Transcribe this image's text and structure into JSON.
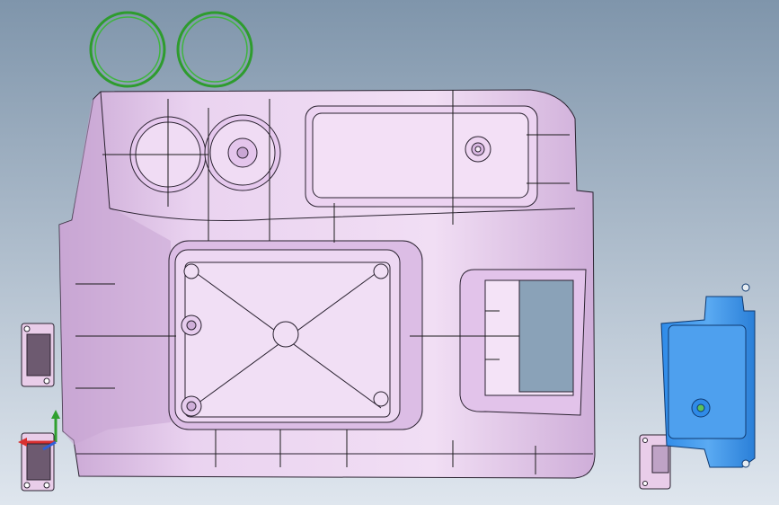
{
  "viewport": {
    "background_top": "#7f95ab",
    "background_bottom": "#dfe6ee"
  },
  "colors": {
    "part_fill": "#e5c9ec",
    "part_fill_dark": "#c9a6d4",
    "part_edge": "#2a2230",
    "ring": "#2e9c2e",
    "blue_part": "#2f8be8",
    "blue_part_light": "#5aaaf2",
    "bracket_fill": "#e9cde9",
    "triad_x": "#d83030",
    "triad_y": "#2fa02f",
    "triad_z": "#2f5fd8"
  },
  "scene": {
    "parts": [
      "main-console-panel",
      "ring-seal-left",
      "ring-seal-right",
      "cup-holder-left",
      "cup-holder-right",
      "storage-tray",
      "top-compartment",
      "hinge-bracket-upper",
      "hinge-bracket-lower",
      "blue-module-cover",
      "small-bracket-right"
    ],
    "triad_icon": "coordinate-triad-icon"
  }
}
